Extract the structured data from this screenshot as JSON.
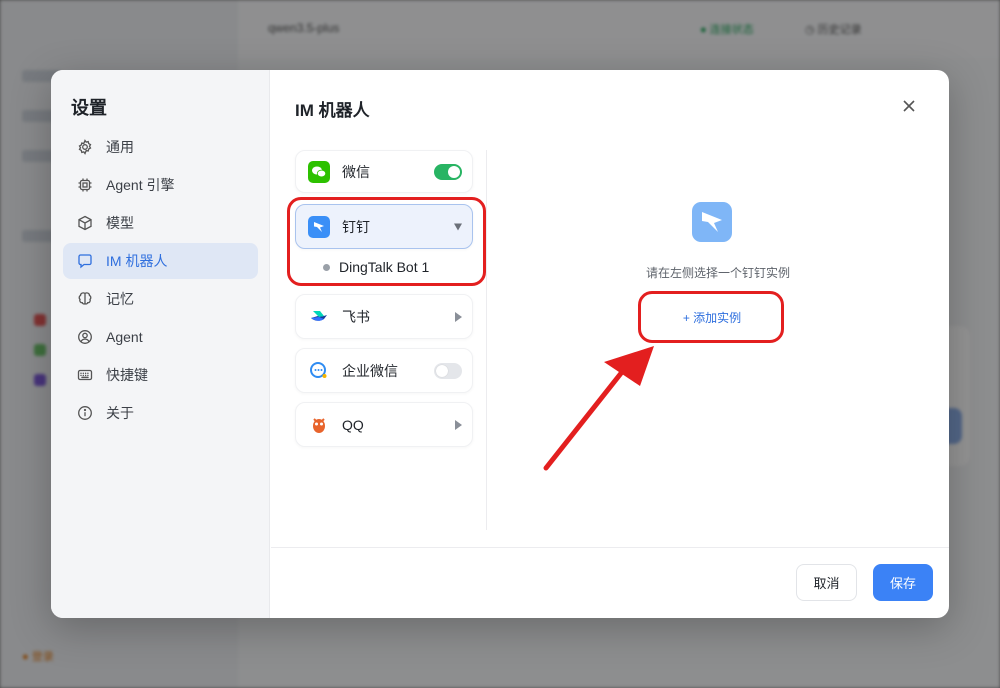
{
  "background": {
    "model_label": "qwen3.5-plus",
    "status_label": "● 连接状态",
    "button_label": "◷ 历史记录",
    "bottom_label": "● 登录"
  },
  "dialog": {
    "title": "设置",
    "content_title": "IM 机器人",
    "nav": [
      {
        "label": "通用",
        "icon": "gear-icon"
      },
      {
        "label": "Agent 引擎",
        "icon": "chip-icon"
      },
      {
        "label": "模型",
        "icon": "cube-icon"
      },
      {
        "label": "IM 机器人",
        "icon": "chat-bubble-icon",
        "active": true
      },
      {
        "label": "记忆",
        "icon": "brain-icon"
      },
      {
        "label": "Agent",
        "icon": "user-circle-icon"
      },
      {
        "label": "快捷键",
        "icon": "keyboard-icon"
      },
      {
        "label": "关于",
        "icon": "info-icon"
      }
    ],
    "platforms": [
      {
        "label": "微信",
        "control": "toggle-on"
      },
      {
        "label": "钉钉",
        "control": "expanded",
        "selected": true
      },
      {
        "label": "飞书",
        "control": "arrow"
      },
      {
        "label": "企业微信",
        "control": "toggle-off"
      },
      {
        "label": "QQ",
        "control": "arrow"
      }
    ],
    "bot_instance": "DingTalk Bot 1",
    "empty_text": "请在左侧选择一个钉钉实例",
    "add_instance": "+ 添加实例",
    "cancel": "取消",
    "save": "保存"
  },
  "colors": {
    "accent": "#3b82f6",
    "toggle_on": "#28b463",
    "annotation": "#e31f1f"
  }
}
